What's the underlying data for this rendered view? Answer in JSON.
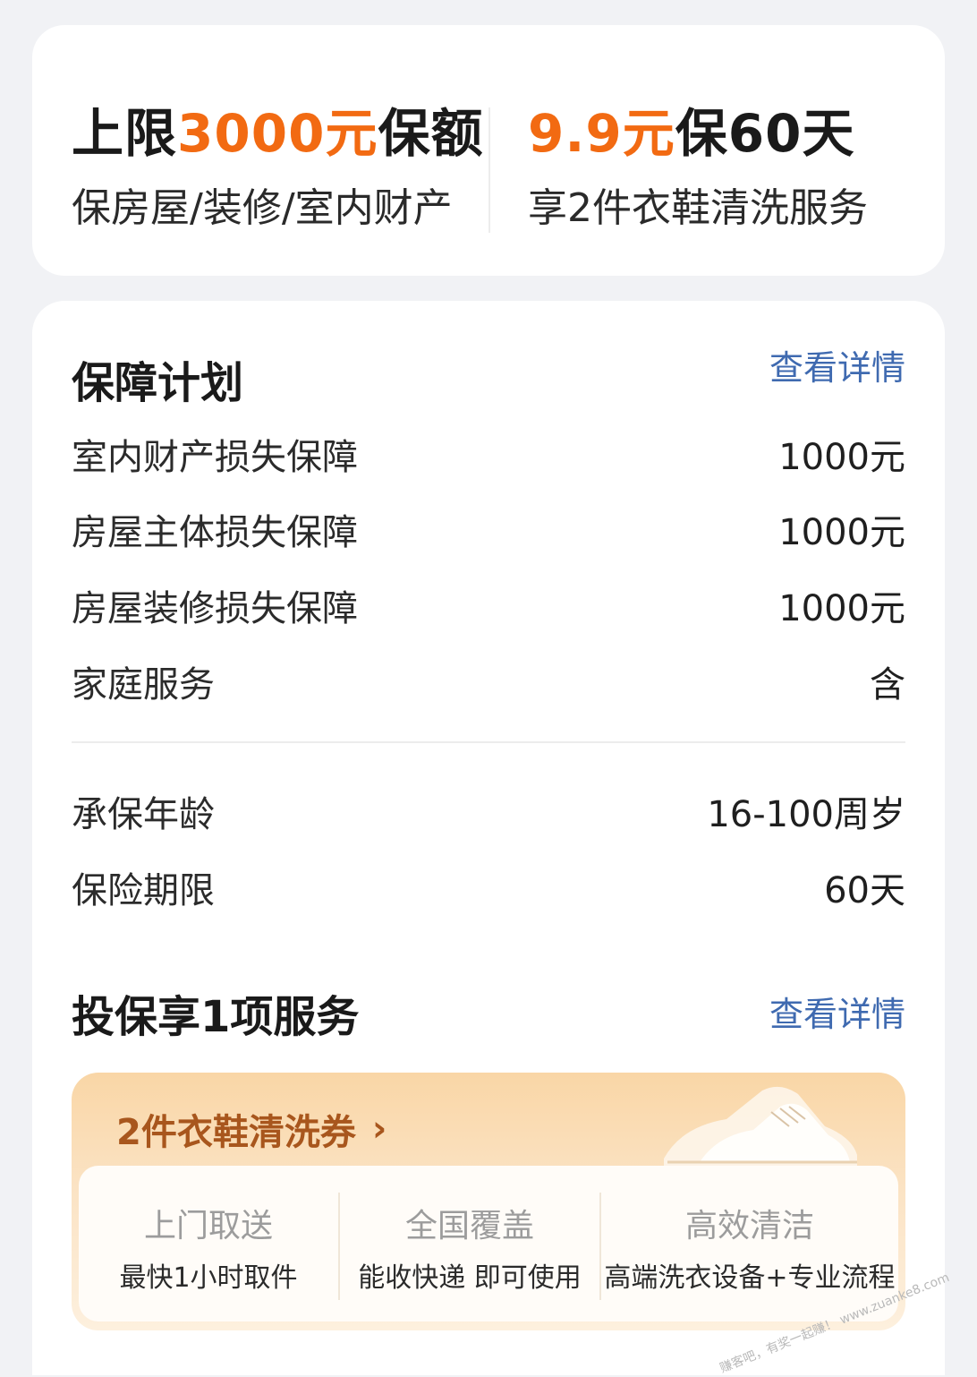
{
  "top_card": {
    "left": {
      "title_prefix": "上限",
      "title_highlight": "3000元",
      "title_suffix": "保额",
      "subtitle": "保房屋/装修/室内财产"
    },
    "right": {
      "title_highlight": "9.9元",
      "title_suffix": "保60天",
      "subtitle": "享2件衣鞋清洗服务"
    }
  },
  "plan": {
    "title": "保障计划",
    "detail_link": "查看详情",
    "items": [
      {
        "label": "室内财产损失保障",
        "value": "1000元"
      },
      {
        "label": "房屋主体损失保障",
        "value": "1000元"
      },
      {
        "label": "房屋装修损失保障",
        "value": "1000元"
      },
      {
        "label": "家庭服务",
        "value": "含"
      }
    ],
    "info": [
      {
        "label": "承保年龄",
        "value": "16-100周岁"
      },
      {
        "label": "保险期限",
        "value": "60天"
      }
    ]
  },
  "services": {
    "title": "投保享1项服务",
    "detail_link": "查看详情",
    "coupon": {
      "title": "2件衣鞋清洗券",
      "features": [
        {
          "title": "上门取送",
          "desc": "最快1小时取件"
        },
        {
          "title": "全国覆盖",
          "desc": "能收快递 即可使用"
        },
        {
          "title": "高效清洁",
          "desc": "高端洗衣设备+专业流程"
        }
      ]
    }
  },
  "watermark": "赚客吧，有奖一起赚！ www.zuanke8.com",
  "colors": {
    "accent_orange": "#f26a12",
    "link_blue": "#3f6ab0",
    "coupon_brown": "#a8561d"
  }
}
